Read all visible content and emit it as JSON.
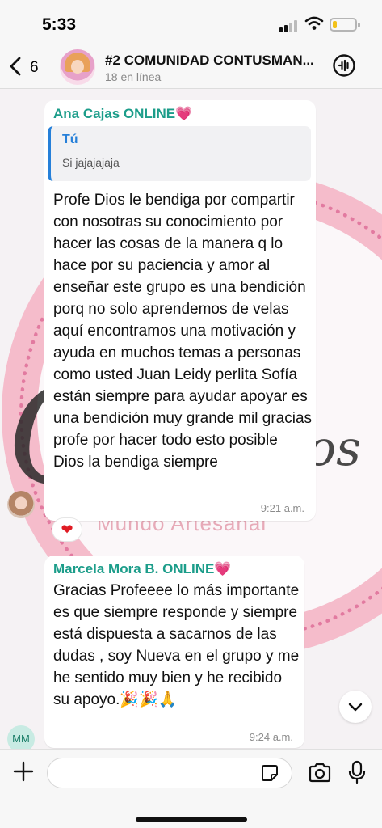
{
  "status_bar": {
    "time": "5:33",
    "battery_level": 0.2
  },
  "header": {
    "back_count": "6",
    "group_name": "#2 COMUNIDAD CONTUSMAN...",
    "online": "18 en línea"
  },
  "wallpaper": {
    "script_text": "C",
    "script_text_2": "os",
    "brand_text": "Mundo Artesanal"
  },
  "messages": [
    {
      "sender": "Ana Cajas ONLINE",
      "sender_emoji": "💗",
      "quoted_author": "Tú",
      "quoted_text": "Si jajajajaja",
      "text": "Profe Dios le bendiga por compartir con nosotras su conocimiento por hacer las cosas de la manera q lo hace por su paciencia y amor al enseñar este grupo es una bendición porq no solo aprendemos de velas aquí encontramos una motivación y ayuda en muchos temas a personas como usted Juan Leidy perlita Sofía están siempre para ayudar apoyar es una bendición muy grande mil gracias profe por hacer todo esto posible Dios la bendiga siempre",
      "time": "9:21 a.m.",
      "reaction": "❤"
    },
    {
      "sender": "Marcela Mora B. ONLINE",
      "sender_emoji": "💗",
      "text": "Gracias Profeeee lo más importante es que siempre responde  y siempre está dispuesta a sacarnos de las dudas , soy Nueva en el grupo y me he sentido muy bien y he recibido su apoyo.🎉🎉🙏",
      "time": "9:24 a.m.",
      "avatar_initials": "MM"
    }
  ],
  "input": {
    "placeholder": ""
  },
  "colors": {
    "sender": "#1c9d8a",
    "quote_bar": "#2680d9",
    "wallpaper_pink": "#f5bccb"
  }
}
